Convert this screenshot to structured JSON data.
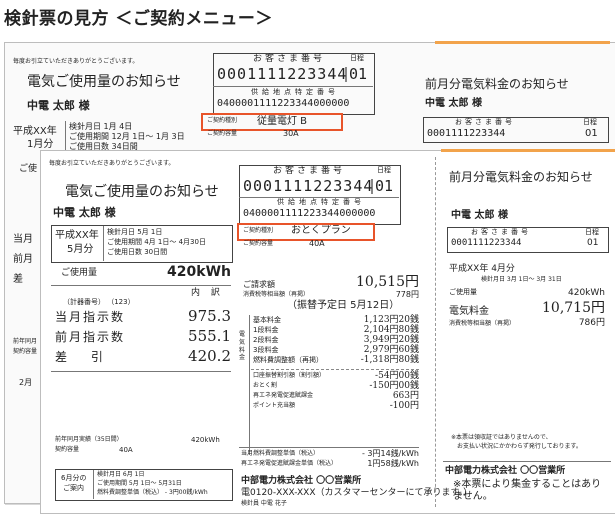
{
  "page": {
    "title": "検針票の見方 ＜ご契約メニュー＞"
  },
  "back": {
    "greeting": "毎度お引立ていただきありがとうございます。",
    "title": "電気ご使用量のお知らせ",
    "name": "中電 太郎 様",
    "customer_no_label": "お客さま番号",
    "customer_no": "0001111223344",
    "day_label": "日程",
    "day": "01",
    "supply_label": "供給地点特定番号",
    "supply_no": "0400001111223344000000",
    "contract_label": "ご契約種別",
    "contract_value": "従量電灯 B",
    "capacity_label": "ご契約容量",
    "capacity_value": "30A",
    "period_era": "平成XX年",
    "period_month": "1月分",
    "meter_date": "検針月日 1月 4日",
    "use_period": "ご使用期間 12月 1日～ 1月 3日",
    "use_days": "ご使用日数 34日間",
    "left_fragments": [
      "ご使",
      "当月",
      "前月",
      "差"
    ],
    "side_fragments": [
      "前年同月",
      "契約容量"
    ],
    "bottom_fragment": "2月",
    "right_title": "前月分電気料金のお知らせ",
    "right_name": "中電 太郎 様",
    "right_no_label": "お客さま番号",
    "right_no": "0001111223344",
    "right_day_label": "日程",
    "right_day": "01"
  },
  "front": {
    "greeting": "毎度お引立ていただきありがとうございます。",
    "title": "電気ご使用量のお知らせ",
    "name": "中電 太郎 様",
    "customer_no_label": "お客さま番号",
    "customer_no": "0001111223344",
    "day_label": "日程",
    "day": "01",
    "supply_label": "供給地点特定番号",
    "supply_no": "0400001111223344000000",
    "contract_label": "ご契約種別",
    "contract_value": "おとくプラン",
    "capacity_label": "ご契約容量",
    "capacity_value": "40A",
    "period_era": "平成XX年",
    "period_month": "5月分",
    "meter_date": "検針月日 5月 1日",
    "use_period": "ご使用期間 4月 1日～ 4月30日",
    "use_days": "ご使用日数 30日間",
    "usage_label": "ご使用量",
    "usage_value": "420kWh",
    "breakdown_label": "内 訳",
    "meter_no": "（計器番号） （123）",
    "readings": [
      {
        "label": "当月指示数",
        "value": "975.3"
      },
      {
        "label": "前月指示数",
        "value": "555.1"
      },
      {
        "label": "差 引",
        "value": "420.2"
      }
    ],
    "last_year_label": "前年同月実績（35日間）",
    "last_year_value": "420kWh",
    "capacity_row_label": "契約容量",
    "capacity_row_value": "40A",
    "next_era": "6月分の",
    "next_notice": "ご案内",
    "next_meter_date": "検針月日 6月 1日",
    "next_use_period": "ご使用期間 5月 1日～ 5月31日",
    "next_fuel": "燃料費調整単価（税込） - 3円00銭/kWh",
    "bill_label": "ご請求額",
    "bill_value": "10,515円",
    "tax_label": "消費税等相当額（再掲）",
    "tax_value": "778円",
    "transfer_label": "（振替予定日 5月12日）",
    "charge_group": "電気料金",
    "charges": [
      {
        "label": "基本料金",
        "value": "1,123円20銭"
      },
      {
        "label": "1段料金",
        "value": "2,104円80銭"
      },
      {
        "label": "2段料金",
        "value": "3,949円20銭"
      },
      {
        "label": "3段料金",
        "value": "2,979円60銭"
      },
      {
        "label": "燃料費調整額（再掲）",
        "value": "-1,318円80銭"
      }
    ],
    "discounts": [
      {
        "label": "口座振替割引額（割引額）",
        "value": "-54円00銭"
      },
      {
        "label": "おとく割",
        "value": "-150円00銭"
      },
      {
        "label": "再エネ発電促進賦課金",
        "value": "663円"
      },
      {
        "label": "ポイント充当額",
        "value": "-100円"
      }
    ],
    "unit_fuel_label": "当月燃料費調整単価（税込）",
    "unit_fuel_value": "- 3円14銭/kWh",
    "unit_renew_label": "再エネ発電促進賦課金単価（税込）",
    "unit_renew_value": "1円58銭/kWh",
    "company": "中部電力株式会社 〇〇営業所",
    "phone": "電0120-XXX-XXX（カスタマーセンターにて承ります。）",
    "inspector": "検針員 中電 花子",
    "right_title": "前月分電気料金のお知らせ",
    "right_name": "中電 太郎 様",
    "right_no_label": "お客さま番号",
    "right_no": "0001111223344",
    "right_day_label": "日程",
    "right_day": "01",
    "right_era": "平成XX年 4月分",
    "right_meter": "検針月日 3月 1日～ 3月 31日",
    "right_usage_label": "ご使用量",
    "right_usage_value": "420kWh",
    "right_fee_label": "電気料金",
    "right_fee_value": "10,715円",
    "right_tax_label": "消費税等相当額（再掲）",
    "right_tax_value": "786円",
    "right_note1": "※本票は領収証ではありませんので、",
    "right_note2": "お支払い状況にかかわらず発行しております。",
    "right_company": "中部電力株式会社 〇〇営業所",
    "right_notice": "※本票により集金することはありません。"
  }
}
